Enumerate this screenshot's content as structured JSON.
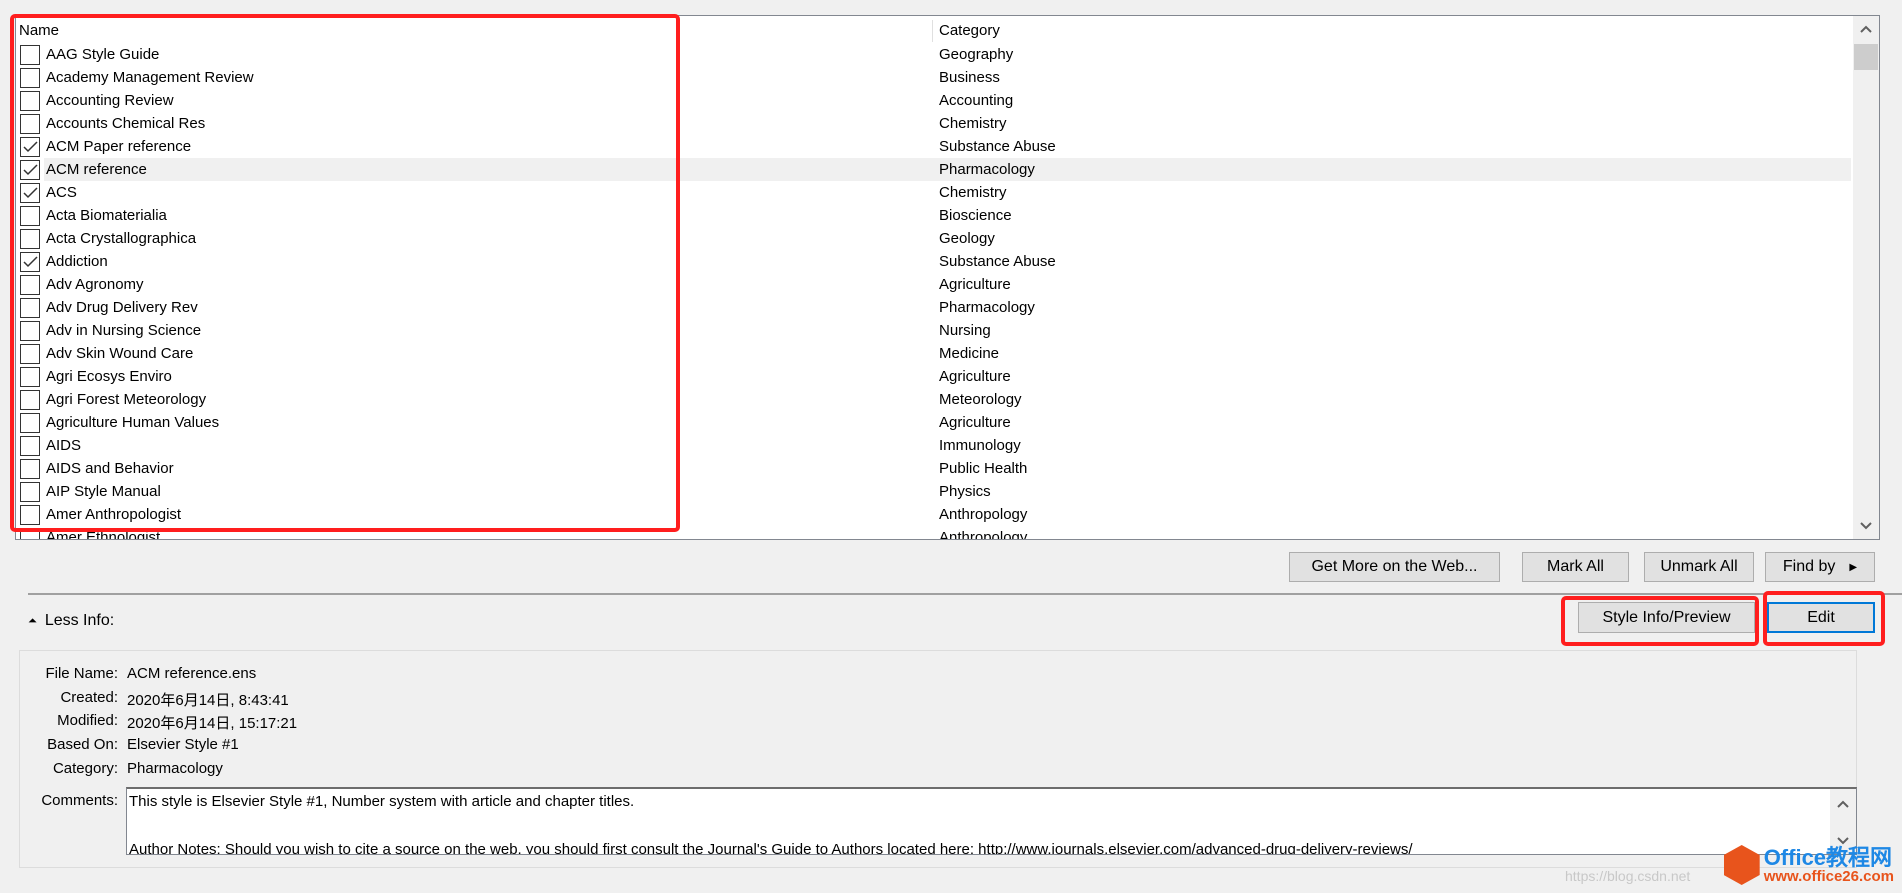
{
  "list": {
    "columns": {
      "name": "Name",
      "category": "Category"
    },
    "rows": [
      {
        "name": "AAG Style Guide",
        "category": "Geography",
        "checked": false
      },
      {
        "name": "Academy Management Review",
        "category": "Business",
        "checked": false
      },
      {
        "name": "Accounting Review",
        "category": "Accounting",
        "checked": false
      },
      {
        "name": "Accounts Chemical Res",
        "category": "Chemistry",
        "checked": false
      },
      {
        "name": "ACM Paper reference",
        "category": "Substance Abuse",
        "checked": true
      },
      {
        "name": "ACM reference",
        "category": "Pharmacology",
        "checked": true,
        "selected": true
      },
      {
        "name": "ACS",
        "category": "Chemistry",
        "checked": true
      },
      {
        "name": "Acta Biomaterialia",
        "category": "Bioscience",
        "checked": false
      },
      {
        "name": "Acta Crystallographica",
        "category": "Geology",
        "checked": false
      },
      {
        "name": "Addiction",
        "category": "Substance Abuse",
        "checked": true
      },
      {
        "name": "Adv Agronomy",
        "category": "Agriculture",
        "checked": false
      },
      {
        "name": "Adv Drug Delivery Rev",
        "category": "Pharmacology",
        "checked": false
      },
      {
        "name": "Adv in Nursing Science",
        "category": "Nursing",
        "checked": false
      },
      {
        "name": "Adv Skin Wound Care",
        "category": "Medicine",
        "checked": false
      },
      {
        "name": "Agri Ecosys Enviro",
        "category": "Agriculture",
        "checked": false
      },
      {
        "name": "Agri Forest Meteorology",
        "category": "Meteorology",
        "checked": false
      },
      {
        "name": "Agriculture Human Values",
        "category": "Agriculture",
        "checked": false
      },
      {
        "name": "AIDS",
        "category": "Immunology",
        "checked": false
      },
      {
        "name": "AIDS and Behavior",
        "category": "Public Health",
        "checked": false
      },
      {
        "name": "AIP Style Manual",
        "category": "Physics",
        "checked": false
      },
      {
        "name": "Amer Anthropologist",
        "category": "Anthropology",
        "checked": false
      },
      {
        "name": "Amer Ethnologist",
        "category": "Anthropology",
        "checked": false
      }
    ]
  },
  "buttons": {
    "get_more": "Get More on the Web...",
    "mark_all": "Mark All",
    "unmark_all": "Unmark All",
    "find_by": "Find by",
    "style_info": "Style Info/Preview",
    "edit": "Edit"
  },
  "less_info": "Less Info:",
  "info": {
    "file_name_label": "File Name:",
    "file_name": "ACM reference.ens",
    "created_label": "Created:",
    "created": "2020年6月14日, 8:43:41",
    "modified_label": "Modified:",
    "modified": "2020年6月14日, 15:17:21",
    "based_on_label": "Based On:",
    "based_on": "Elsevier Style #1",
    "category_label": "Category:",
    "category": "Pharmacology",
    "comments_label": "Comments:",
    "comments_line1": "This style is Elsevier Style #1, Number system with article and chapter titles.",
    "comments_line2": "Author Notes: Should you wish to cite a source on the web, you should first consult the Journal's Guide to Authors located here: http://www.journals.elsevier.com/advanced-drug-delivery-reviews/"
  },
  "watermark": {
    "brand": "Office教程网",
    "url": "www.office26.com",
    "faint": "https://blog.csdn.net"
  },
  "colors": {
    "highlight_red": "#ff1e1e",
    "focus_blue": "#0078d7",
    "watermark_orange": "#e8541c"
  }
}
